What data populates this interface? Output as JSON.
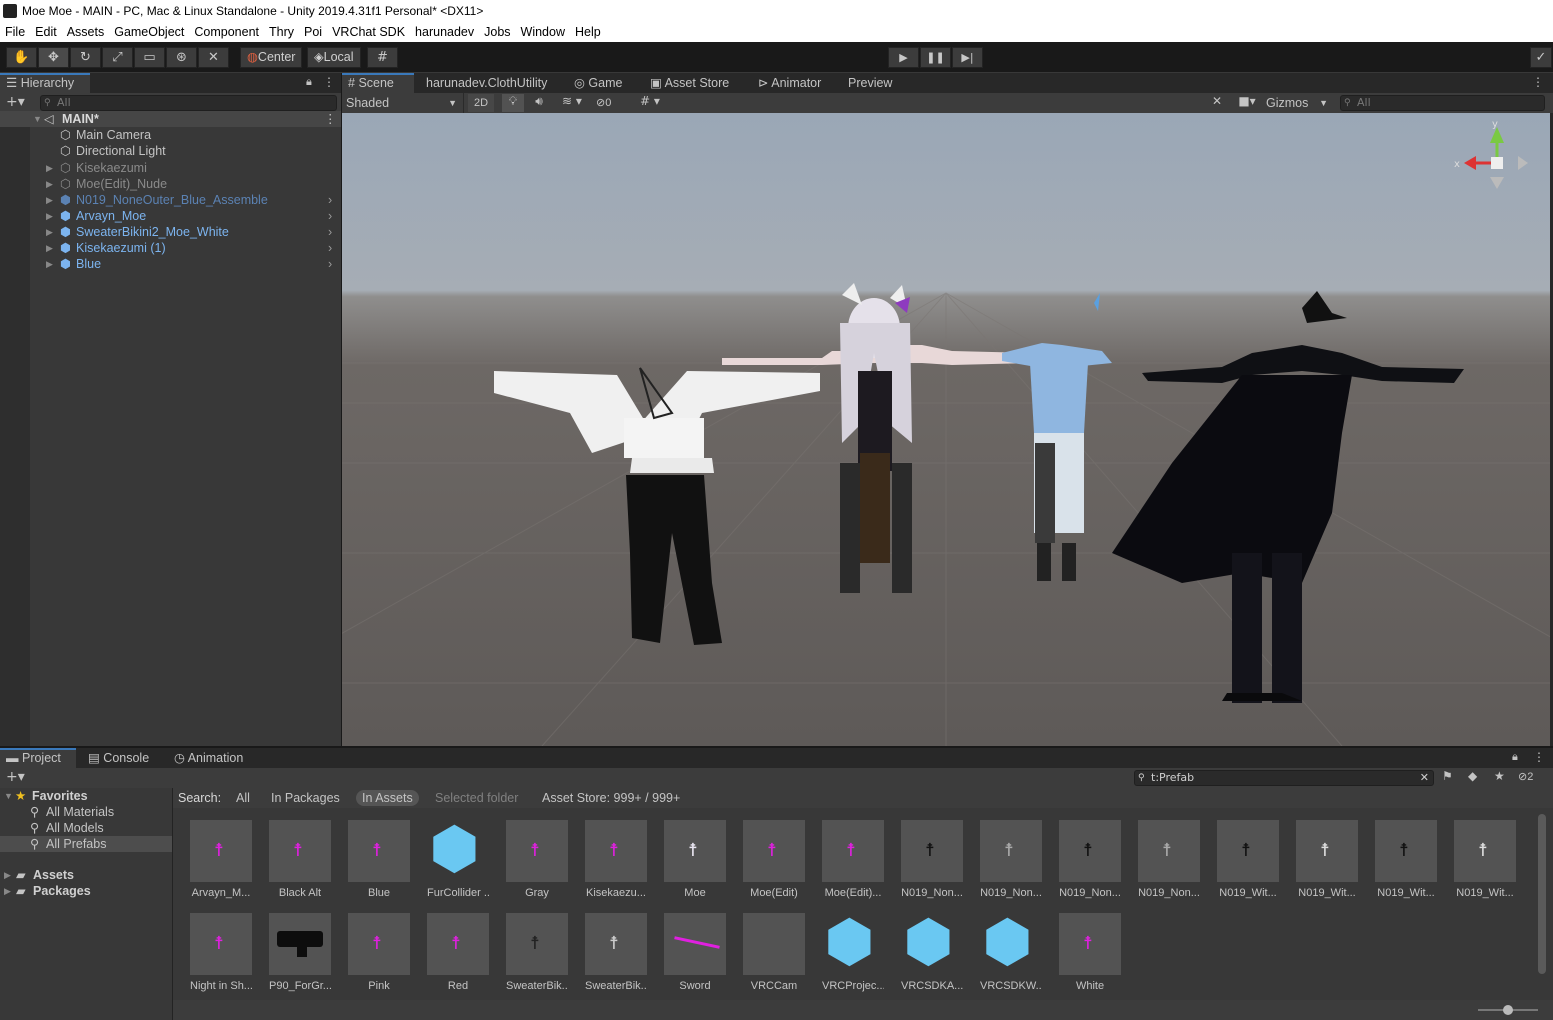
{
  "window": {
    "title": "Moe Moe - MAIN - PC, Mac & Linux Standalone - Unity 2019.4.31f1 Personal* <DX11>"
  },
  "menu": [
    "File",
    "Edit",
    "Assets",
    "GameObject",
    "Component",
    "Thry",
    "Poi",
    "VRChat SDK",
    "harunadev",
    "Jobs",
    "Window",
    "Help"
  ],
  "toolbar": {
    "pivot_label": "Center",
    "space_label": "Local"
  },
  "hierarchy": {
    "tab_label": "Hierarchy",
    "search_placeholder": "All",
    "scene_name": "MAIN*",
    "items": [
      {
        "label": "Main Camera",
        "style": "normal"
      },
      {
        "label": "Directional Light",
        "style": "normal"
      },
      {
        "label": "Kisekaezumi",
        "style": "inactive"
      },
      {
        "label": "Moe(Edit)_Nude",
        "style": "inactive"
      },
      {
        "label": "N019_NoneOuter_Blue_Assemble",
        "style": "prefab-inactive"
      },
      {
        "label": "Arvayn_Moe",
        "style": "prefab"
      },
      {
        "label": "SweaterBikini2_Moe_White",
        "style": "prefab"
      },
      {
        "label": "Kisekaezumi (1)",
        "style": "prefab"
      },
      {
        "label": "Blue",
        "style": "prefab"
      }
    ]
  },
  "scene": {
    "tabs": [
      "Scene",
      "harunadev.ClothUtility",
      "Game",
      "Asset Store",
      "Animator",
      "Preview"
    ],
    "shading_mode": "Shaded",
    "mode_2d": "2D",
    "hidden_count": "0",
    "gizmos_label": "Gizmos",
    "search_placeholder": "All",
    "gizmo_axes": {
      "x": "x",
      "y": "y"
    }
  },
  "project": {
    "tabs": [
      "Project",
      "Console",
      "Animation"
    ],
    "search_value": "t:Prefab",
    "hidden_count": "2",
    "favorites_label": "Favorites",
    "favorites": [
      "All Materials",
      "All Models",
      "All Prefabs"
    ],
    "folders": [
      "Assets",
      "Packages"
    ],
    "search_bar": {
      "label": "Search:",
      "options": [
        "All",
        "In Packages",
        "In Assets",
        "Selected folder"
      ],
      "active": "In Assets",
      "asset_store": "Asset Store: 999+ / 999+"
    },
    "assets_row1": [
      {
        "label": "Arvayn_M...",
        "icon": "magenta-figure"
      },
      {
        "label": "Black Alt",
        "icon": "magenta-figure"
      },
      {
        "label": "Blue",
        "icon": "magenta-figure"
      },
      {
        "label": "FurCollider ...",
        "icon": "prefab-cube"
      },
      {
        "label": "Gray",
        "icon": "magenta-figure"
      },
      {
        "label": "Kisekaezu...",
        "icon": "magenta-figure"
      },
      {
        "label": "Moe",
        "icon": "white-figure"
      },
      {
        "label": "Moe(Edit)",
        "icon": "magenta-figure"
      },
      {
        "label": "Moe(Edit)...",
        "icon": "magenta-figure"
      },
      {
        "label": "N019_Non...",
        "icon": "black-figure"
      },
      {
        "label": "N019_Non...",
        "icon": "grey-figure"
      },
      {
        "label": "N019_Non...",
        "icon": "black-figure"
      },
      {
        "label": "N019_Non...",
        "icon": "grey-figure"
      },
      {
        "label": "N019_Wit...",
        "icon": "black-figure"
      },
      {
        "label": "N019_Wit...",
        "icon": "white-figure"
      },
      {
        "label": "N019_Wit...",
        "icon": "black-figure"
      },
      {
        "label": "N019_Wit...",
        "icon": "white-figure"
      }
    ],
    "assets_row2": [
      {
        "label": "Night in Sh...",
        "icon": "magenta-figure"
      },
      {
        "label": "P90_ForGr...",
        "icon": "gun"
      },
      {
        "label": "Pink",
        "icon": "magenta-figure"
      },
      {
        "label": "Red",
        "icon": "magenta-figure"
      },
      {
        "label": "SweaterBik...",
        "icon": "grey-figure"
      },
      {
        "label": "SweaterBik...",
        "icon": "grey-figure"
      },
      {
        "label": "Sword",
        "icon": "sword"
      },
      {
        "label": "VRCCam",
        "icon": "empty"
      },
      {
        "label": "VRCProjec...",
        "icon": "prefab-cube"
      },
      {
        "label": "VRCSDKA...",
        "icon": "prefab-cube"
      },
      {
        "label": "VRCSDKW...",
        "icon": "prefab-cube"
      },
      {
        "label": "White",
        "icon": "magenta-figure"
      }
    ]
  }
}
